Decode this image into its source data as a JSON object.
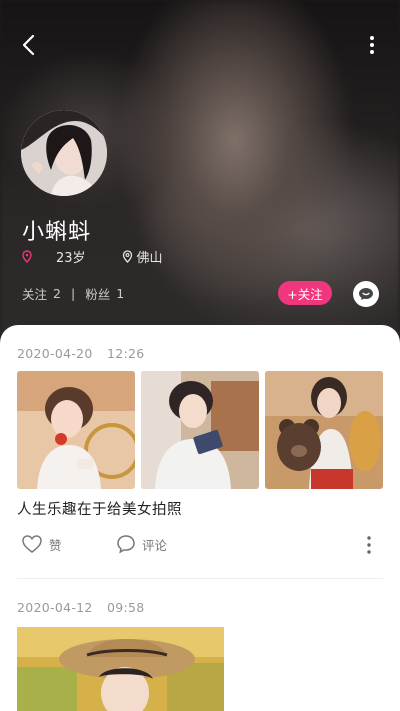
{
  "profile": {
    "username": "小蝌蚪",
    "age": "23岁",
    "location": "佛山",
    "following_label": "关注",
    "following_count": "2",
    "followers_label": "粉丝",
    "followers_count": "1",
    "follow_button": "+关注"
  },
  "posts": [
    {
      "date": "2020-04-20",
      "time": "12:26",
      "text": "人生乐趣在于给美女拍照",
      "like_label": "赞",
      "comment_label": "评论"
    },
    {
      "date": "2020-04-12",
      "time": "09:58"
    }
  ],
  "colors": {
    "accent": "#f0367c",
    "icon_gray": "#777777"
  },
  "icons": [
    "back-arrow-icon",
    "more-vertical-icon",
    "location-pin-icon",
    "map-pin-icon",
    "chat-bubble-icon",
    "heart-icon",
    "comment-icon"
  ]
}
